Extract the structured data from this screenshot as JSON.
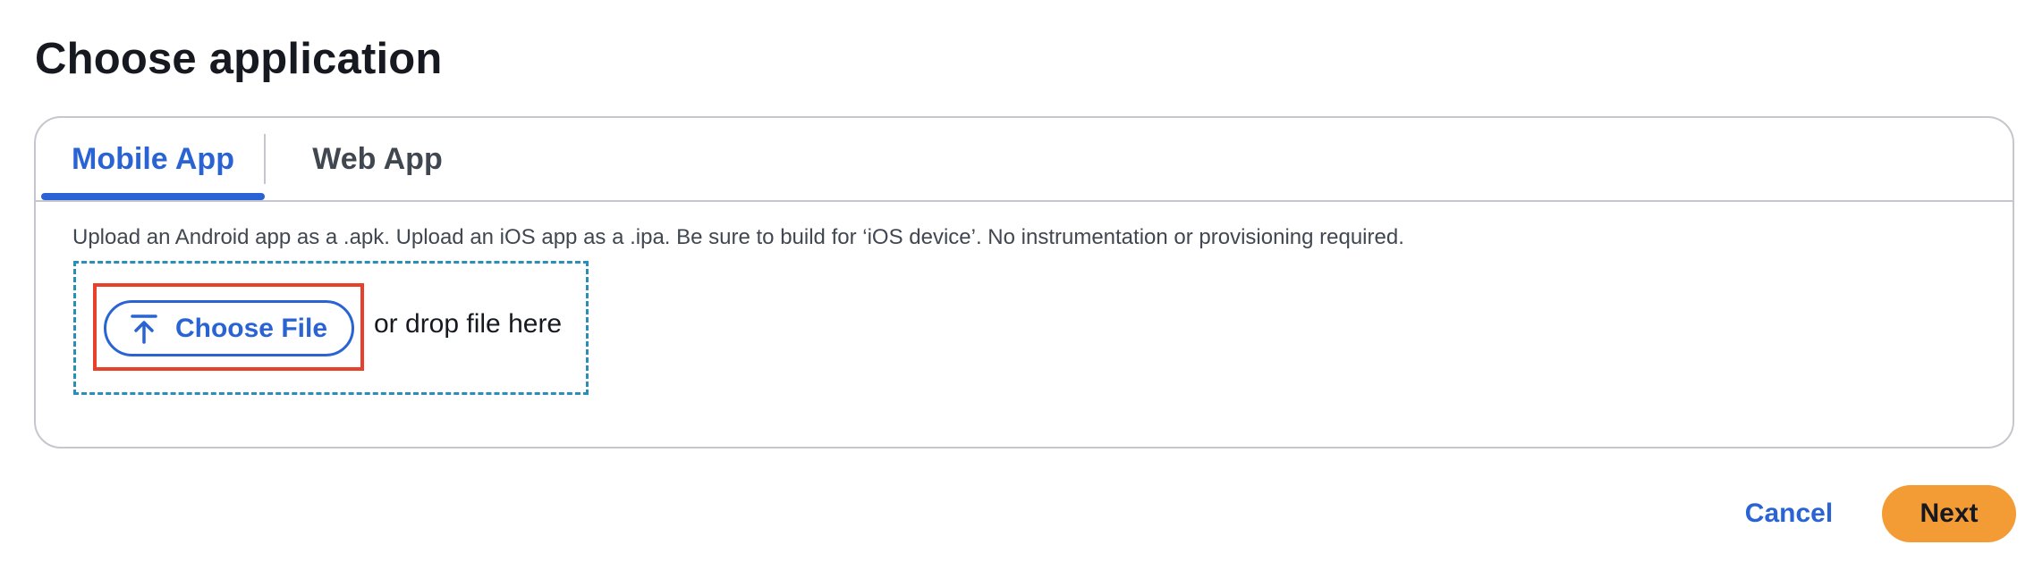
{
  "page": {
    "title": "Choose application"
  },
  "tabs": [
    {
      "label": "Mobile App",
      "selected": true
    },
    {
      "label": "Web App",
      "selected": false
    }
  ],
  "upload": {
    "description": "Upload an Android app as a .apk. Upload an iOS app as a .ipa. Be sure to build for ‘iOS device’. No instrumentation or provisioning required.",
    "choose_file_label": "Choose File",
    "choose_file_icon": "upload-icon",
    "drop_text": "or drop file here"
  },
  "footer": {
    "cancel_label": "Cancel",
    "next_label": "Next"
  },
  "colors": {
    "accent": "#2a63d4",
    "primary_button": "#f39b35",
    "highlight_border": "#e8402a",
    "dropzone_border": "#2a8fb8"
  }
}
